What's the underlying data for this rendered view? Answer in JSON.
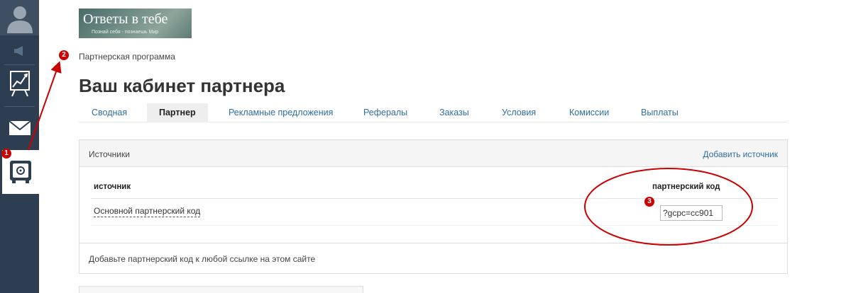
{
  "logo": {
    "title": "Ответы в тебе",
    "subtitle": "Познай себя - познаешь Мир"
  },
  "breadcrumb": "Партнерская программа",
  "page_title": "Ваш кабинет партнера",
  "tabs": [
    {
      "label": "Сводная",
      "active": false
    },
    {
      "label": "Партнер",
      "active": true
    },
    {
      "label": "Рекламные предложения",
      "active": false
    },
    {
      "label": "Рефералы",
      "active": false
    },
    {
      "label": "Заказы",
      "active": false
    },
    {
      "label": "Условия",
      "active": false
    },
    {
      "label": "Комиссии",
      "active": false
    },
    {
      "label": "Выплаты",
      "active": false
    }
  ],
  "sources": {
    "title": "Источники",
    "add_link": "Добавить источник",
    "columns": {
      "source": "источник",
      "code": "партнерский код"
    },
    "rows": [
      {
        "name": "Основной партнерский код",
        "code": "?gcpc=cc901"
      }
    ],
    "footer": "Добавьте партнерский код к любой ссылке на этом сайте"
  },
  "annotations": {
    "badge_1": "1",
    "badge_2": "2",
    "badge_3": "3"
  },
  "sidebar": {
    "icons": [
      "avatar-icon",
      "speaker-icon",
      "chart-icon",
      "mail-icon",
      "safe-icon"
    ],
    "active_icon": "safe-icon"
  },
  "colors": {
    "sidebar": "#2c3e50",
    "link": "#2e6f9e",
    "annotation": "#cc0000"
  }
}
